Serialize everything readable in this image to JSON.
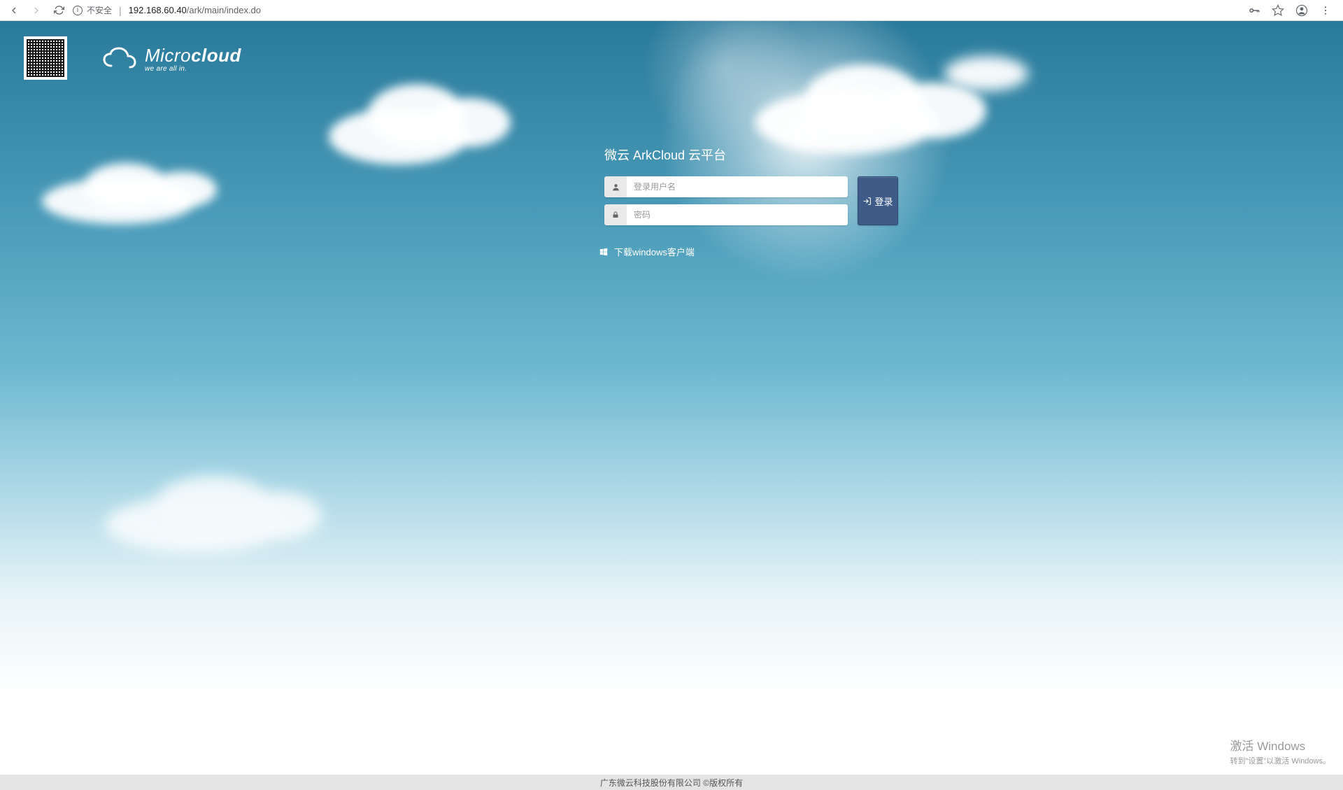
{
  "browser": {
    "security_label": "不安全",
    "url_host": "192.168.60.40",
    "url_path": "/ark/main/index.do"
  },
  "branding": {
    "logo_prefix": "Micro",
    "logo_suffix": "cloud",
    "logo_tagline": "we are all in."
  },
  "login": {
    "title": "微云 ArkCloud 云平台",
    "username_placeholder": "登录用户名",
    "password_placeholder": "密码",
    "button_label": "登录"
  },
  "download": {
    "label": "下载windows客户端"
  },
  "footer": {
    "text": "广东微云科技股份有限公司 ©版权所有"
  },
  "watermark": {
    "title": "激活 Windows",
    "sub": "转到\"设置\"以激活 Windows。"
  }
}
